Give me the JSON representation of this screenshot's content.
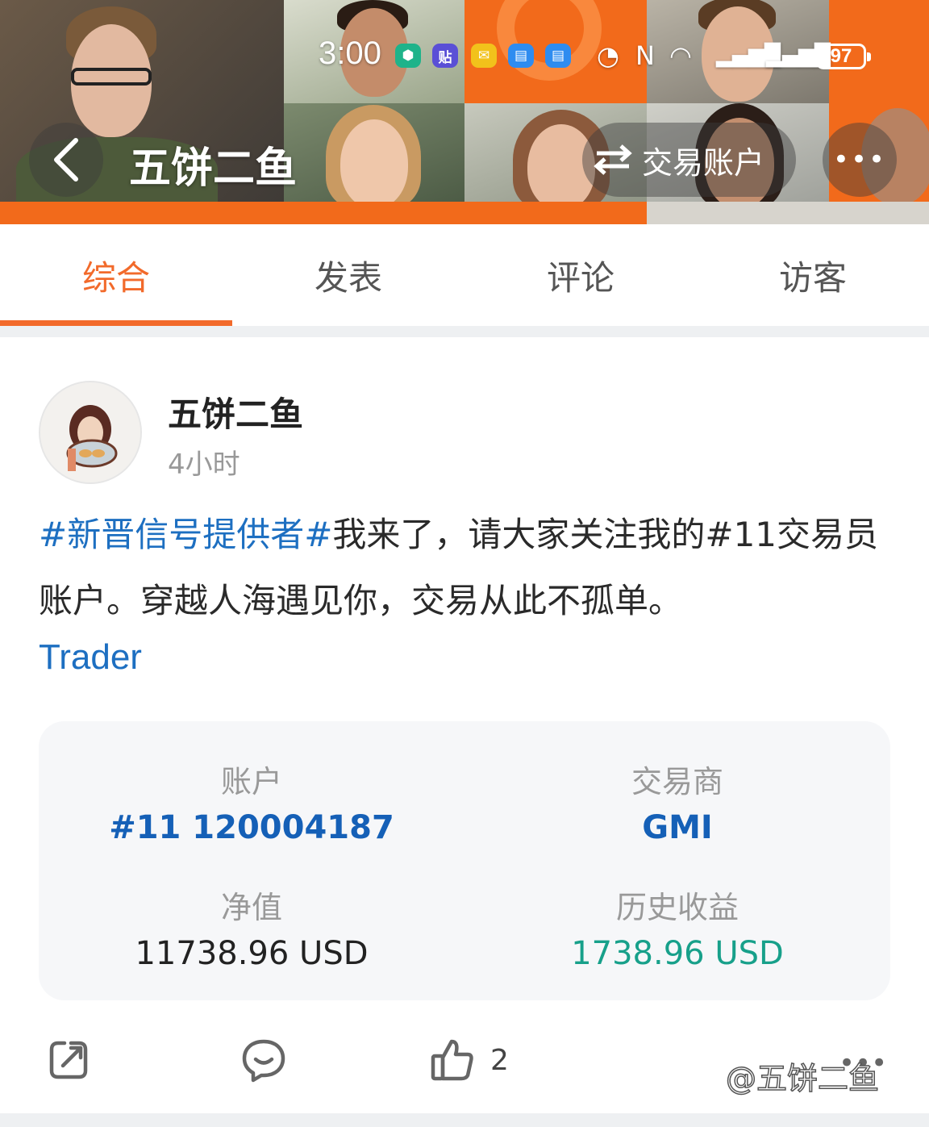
{
  "statusbar": {
    "time": "3:00",
    "battery": "97"
  },
  "header": {
    "title": "五饼二鱼",
    "switch_label": "交易账户",
    "more_label": "•••"
  },
  "tabs": [
    {
      "label": "综合",
      "active": true
    },
    {
      "label": "发表",
      "active": false
    },
    {
      "label": "评论",
      "active": false
    },
    {
      "label": "访客",
      "active": false
    }
  ],
  "post": {
    "author": "五饼二鱼",
    "time_ago": "4小时",
    "hashtag": "#新晋信号提供者#",
    "text_rest": "我来了，请大家关注我的#11交易员账户。穿越人海遇见你，交易从此不孤单。",
    "link": "Trader"
  },
  "account_card": {
    "account_label": "账户",
    "account_value": "#11 120004187",
    "broker_label": "交易商",
    "broker_value": "GMI",
    "equity_label": "净值",
    "equity_value": "11738.96 USD",
    "profit_label": "历史收益",
    "profit_value": "1738.96 USD"
  },
  "actions": {
    "like_count": "2"
  },
  "watermark": "@五饼二鱼",
  "colors": {
    "accent": "#f26a2b",
    "link": "#1d6fc1",
    "profit": "#17a08a"
  }
}
